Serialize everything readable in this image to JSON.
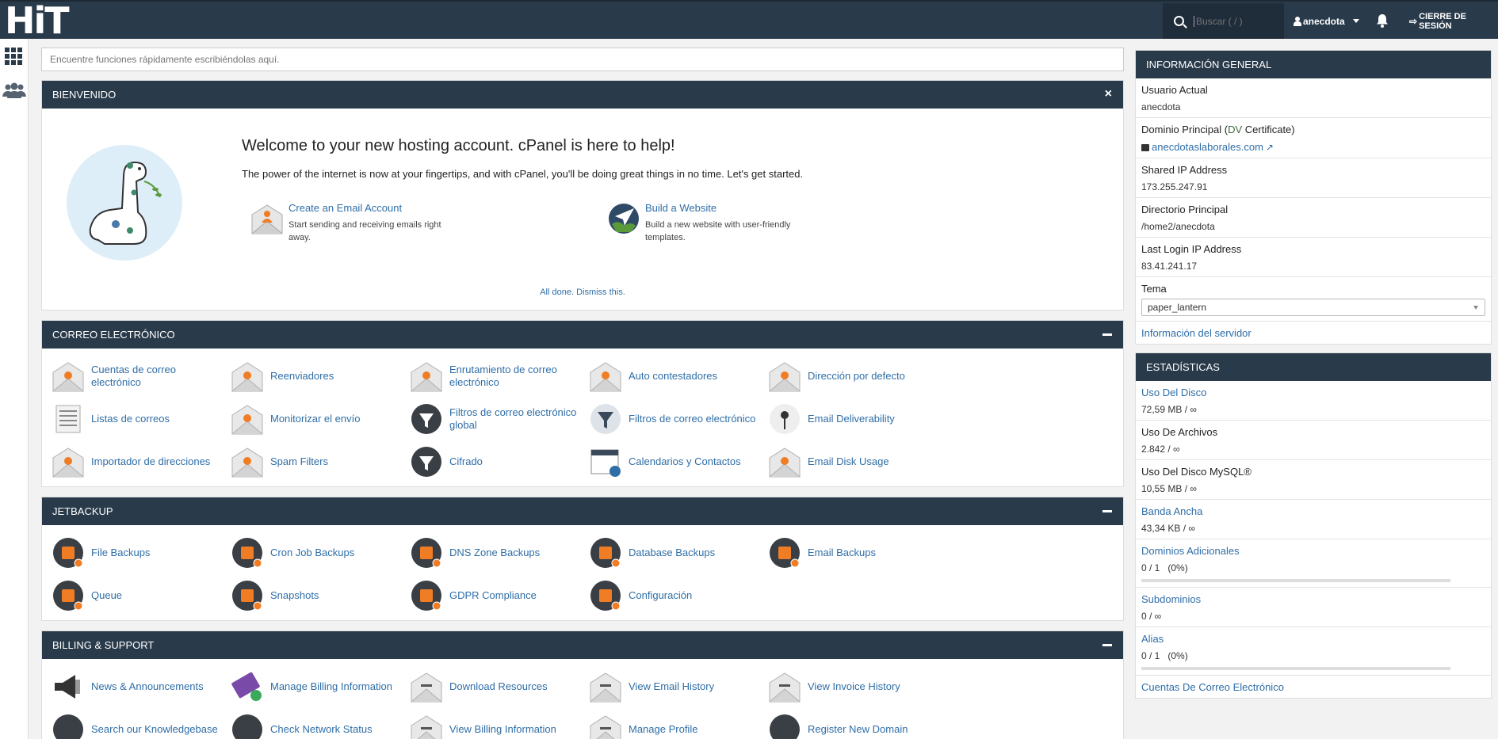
{
  "header": {
    "logo": "HiT",
    "search_placeholder": "Buscar ( / )",
    "user": "anecdota",
    "logout": "CIERRE DE SESIÓN",
    "colors": {
      "navbar": "#293a4a",
      "link": "#2f6ea7",
      "accent": "#f07c23"
    }
  },
  "quickfind": {
    "placeholder": "Encuentre funciones rápidamente escribiéndolas aquí."
  },
  "welcome": {
    "panel_title": "BIENVENIDO",
    "close": "×",
    "heading": "Welcome to your new hosting account. cPanel is here to help!",
    "lead": "The power of the internet is now at your fingertips, and with cPanel, you'll be doing great things in no time. Let's get started.",
    "items": [
      {
        "title": "Create an Email Account",
        "desc": "Start sending and receiving emails right away.",
        "icon": "envelope-person-icon"
      },
      {
        "title": "Build a Website",
        "desc": "Build a new website with user-friendly templates.",
        "icon": "paper-plane-globe-icon"
      }
    ],
    "dismiss": "All done. Dismiss this."
  },
  "sections": [
    {
      "title": "CORREO ELECTRÓNICO",
      "items": [
        {
          "label": "Cuentas de correo electrónico",
          "icon": "email-accounts-icon"
        },
        {
          "label": "Reenviadores",
          "icon": "forwarders-icon"
        },
        {
          "label": "Enrutamiento de correo electrónico",
          "icon": "email-routing-icon"
        },
        {
          "label": "Auto contestadores",
          "icon": "autoresponders-icon"
        },
        {
          "label": "Dirección por defecto",
          "icon": "default-address-icon"
        },
        {
          "label": "Listas de correos",
          "icon": "mailing-lists-icon"
        },
        {
          "label": "Monitorizar el envío",
          "icon": "track-delivery-icon"
        },
        {
          "label": "Filtros de correo electrónico global",
          "icon": "global-filters-icon"
        },
        {
          "label": "Filtros de correo electrónico",
          "icon": "email-filters-icon"
        },
        {
          "label": "Email Deliverability",
          "icon": "email-deliverability-icon"
        },
        {
          "label": "Importador de direcciones",
          "icon": "address-importer-icon"
        },
        {
          "label": "Spam Filters",
          "icon": "spam-filters-icon"
        },
        {
          "label": "Cifrado",
          "icon": "encryption-key-icon"
        },
        {
          "label": "Calendarios y Contactos",
          "icon": "calendars-contacts-icon"
        },
        {
          "label": "Email Disk Usage",
          "icon": "email-disk-usage-icon"
        }
      ]
    },
    {
      "title": "JETBACKUP",
      "items": [
        {
          "label": "File Backups",
          "icon": "file-backups-icon"
        },
        {
          "label": "Cron Job Backups",
          "icon": "cron-job-backups-icon"
        },
        {
          "label": "DNS Zone Backups",
          "icon": "dns-zone-backups-icon"
        },
        {
          "label": "Database Backups",
          "icon": "database-backups-icon"
        },
        {
          "label": "Email Backups",
          "icon": "email-backups-icon"
        },
        {
          "label": "Queue",
          "icon": "queue-icon"
        },
        {
          "label": "Snapshots",
          "icon": "snapshots-icon"
        },
        {
          "label": "GDPR Compliance",
          "icon": "gdpr-compliance-icon"
        },
        {
          "label": "Configuración",
          "icon": "configuration-gear-icon"
        }
      ]
    },
    {
      "title": "BILLING & SUPPORT",
      "items": [
        {
          "label": "News & Announcements",
          "icon": "megaphone-icon"
        },
        {
          "label": "Manage Billing Information",
          "icon": "credit-card-icon"
        },
        {
          "label": "Download Resources",
          "icon": "download-icon"
        },
        {
          "label": "View Email History",
          "icon": "email-history-icon"
        },
        {
          "label": "View Invoice History",
          "icon": "invoice-icon"
        },
        {
          "label": "Search our Knowledgebase",
          "icon": "knowledgebase-icon"
        },
        {
          "label": "Check Network Status",
          "icon": "network-status-icon"
        },
        {
          "label": "View Billing Information",
          "icon": "billing-info-icon"
        },
        {
          "label": "Manage Profile",
          "icon": "profile-icon"
        },
        {
          "label": "Register New Domain",
          "icon": "register-domain-icon"
        }
      ]
    }
  ],
  "general_info": {
    "title": "INFORMACIÓN GENERAL",
    "current_user_label": "Usuario Actual",
    "current_user": "anecdota",
    "primary_domain_label": "Dominio Principal (",
    "dv": "DV",
    "certificate": " Certificate)",
    "domain": "anecdotaslaborales.com",
    "shared_ip_label": "Shared IP Address",
    "shared_ip": "173.255.247.91",
    "home_dir_label": "Directorio Principal",
    "home_dir": "/home2/anecdota",
    "last_login_label": "Last Login IP Address",
    "last_login": "83.41.241.17",
    "theme_label": "Tema",
    "theme": "paper_lantern",
    "server_info": "Información del servidor"
  },
  "stats": {
    "title": "ESTADÍSTICAS",
    "rows": [
      {
        "label": "Uso Del Disco",
        "value": "72,59 MB / ∞",
        "link": true
      },
      {
        "label": "Uso De Archivos",
        "value": "2.842 / ∞",
        "link": false
      },
      {
        "label": "Uso Del Disco MySQL®",
        "value": "10,55 MB / ∞",
        "link": false
      },
      {
        "label": "Banda Ancha",
        "value": "43,34 KB / ∞",
        "link": true
      },
      {
        "label": "Dominios Adicionales",
        "value": "0 / 1   (0%)",
        "link": true,
        "progress": 0
      },
      {
        "label": "Subdominios",
        "value": "0 / ∞",
        "link": true
      },
      {
        "label": "Alias",
        "value": "0 / 1   (0%)",
        "link": true,
        "progress": 0
      },
      {
        "label": "Cuentas De Correo Electrónico",
        "value": "",
        "link": true
      }
    ]
  }
}
